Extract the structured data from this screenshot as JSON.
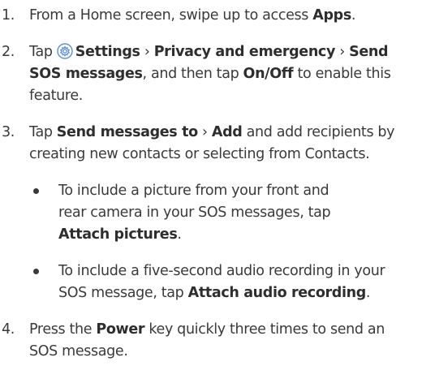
{
  "steps": [
    {
      "number": "1.",
      "parts": [
        "From a Home screen, swipe up to access ",
        "Apps",
        "."
      ]
    },
    {
      "number": "2.",
      "parts": [
        "Tap ",
        "Settings",
        " › ",
        "Privacy and emergency",
        " › ",
        "Send",
        "SOS messages",
        ", and then tap ",
        "On/Off",
        " to enable this",
        "feature."
      ],
      "icon": "settings-gear-icon",
      "icon_color": "#5b8ed8"
    },
    {
      "number": "3.",
      "parts": [
        "Tap ",
        "Send messages to",
        " › ",
        "Add",
        " and add recipients by",
        "creating new contacts or selecting from Contacts."
      ]
    },
    {
      "number": "4.",
      "parts": [
        "Press the ",
        "Power",
        " key quickly three times to send an",
        "SOS message."
      ]
    }
  ],
  "bullets": [
    {
      "lines": [
        "To include a picture from your front and",
        "rear camera in your SOS messages, tap",
        "Attach pictures",
        "."
      ]
    },
    {
      "parts": [
        "To include a five-second audio recording in your",
        "SOS message, tap ",
        "Attach audio recording",
        "."
      ]
    }
  ]
}
